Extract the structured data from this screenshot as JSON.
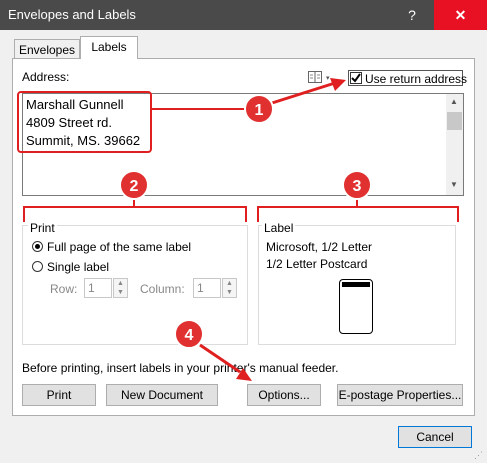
{
  "window": {
    "title": "Envelopes and Labels",
    "help": "?",
    "close": "✕"
  },
  "tabs": [
    {
      "label": "Envelopes"
    },
    {
      "label": "Labels"
    }
  ],
  "address": {
    "label": "Address:",
    "lines": [
      "Marshall Gunnell",
      "4809 Street rd.",
      "Summit, MS. 39662"
    ],
    "use_return_label": "Use return address",
    "use_return_checked": true
  },
  "print": {
    "legend": "Print",
    "full_page": "Full page of the same label",
    "single": "Single label",
    "row_label": "Row:",
    "row_value": "1",
    "column_label": "Column:",
    "column_value": "1"
  },
  "label": {
    "legend": "Label",
    "line1": "Microsoft, 1/2 Letter",
    "line2": "1/2 Letter Postcard"
  },
  "note": "Before printing, insert labels in your printer's manual feeder.",
  "buttons": {
    "print": "Print",
    "new_document": "New Document",
    "options": "Options...",
    "epostage": "E-postage Properties...",
    "cancel": "Cancel"
  },
  "callouts": [
    "1",
    "2",
    "3",
    "4"
  ],
  "colors": {
    "callout": "#e03030",
    "titlebar": "#4a4a4a",
    "close": "#e81123"
  }
}
